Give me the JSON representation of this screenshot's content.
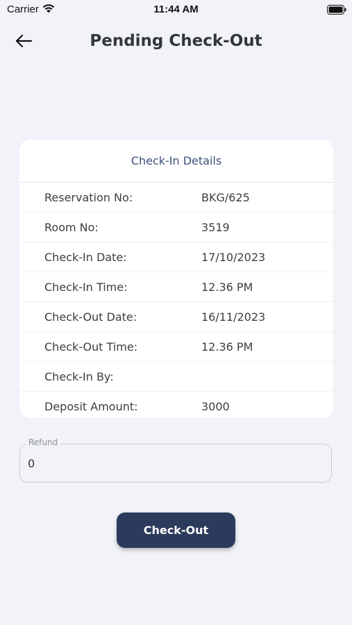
{
  "status_bar": {
    "carrier": "Carrier",
    "time": "11:44 AM",
    "icons": [
      "wifi-icon",
      "battery-icon"
    ]
  },
  "header": {
    "title": "Pending Check-Out",
    "back_icon": "arrow-left-icon"
  },
  "card": {
    "title": "Check-In Details",
    "rows": [
      {
        "label": "Reservation No:",
        "value": "BKG/625"
      },
      {
        "label": "Room No:",
        "value": "3519"
      },
      {
        "label": "Check-In Date:",
        "value": "17/10/2023"
      },
      {
        "label": "Check-In Time:",
        "value": "12.36 PM"
      },
      {
        "label": "Check-Out Date:",
        "value": "16/11/2023"
      },
      {
        "label": "Check-Out Time:",
        "value": "12.36 PM"
      },
      {
        "label": "Check-In By:",
        "value": ""
      },
      {
        "label": "Deposit Amount:",
        "value": "3000"
      }
    ]
  },
  "refund": {
    "label": "Refund",
    "value": "0"
  },
  "checkout_button": {
    "label": "Check-Out"
  },
  "colors": {
    "background": "#f2f3f9",
    "accent": "#2c3b5c",
    "card_title": "#3b4f7a"
  }
}
